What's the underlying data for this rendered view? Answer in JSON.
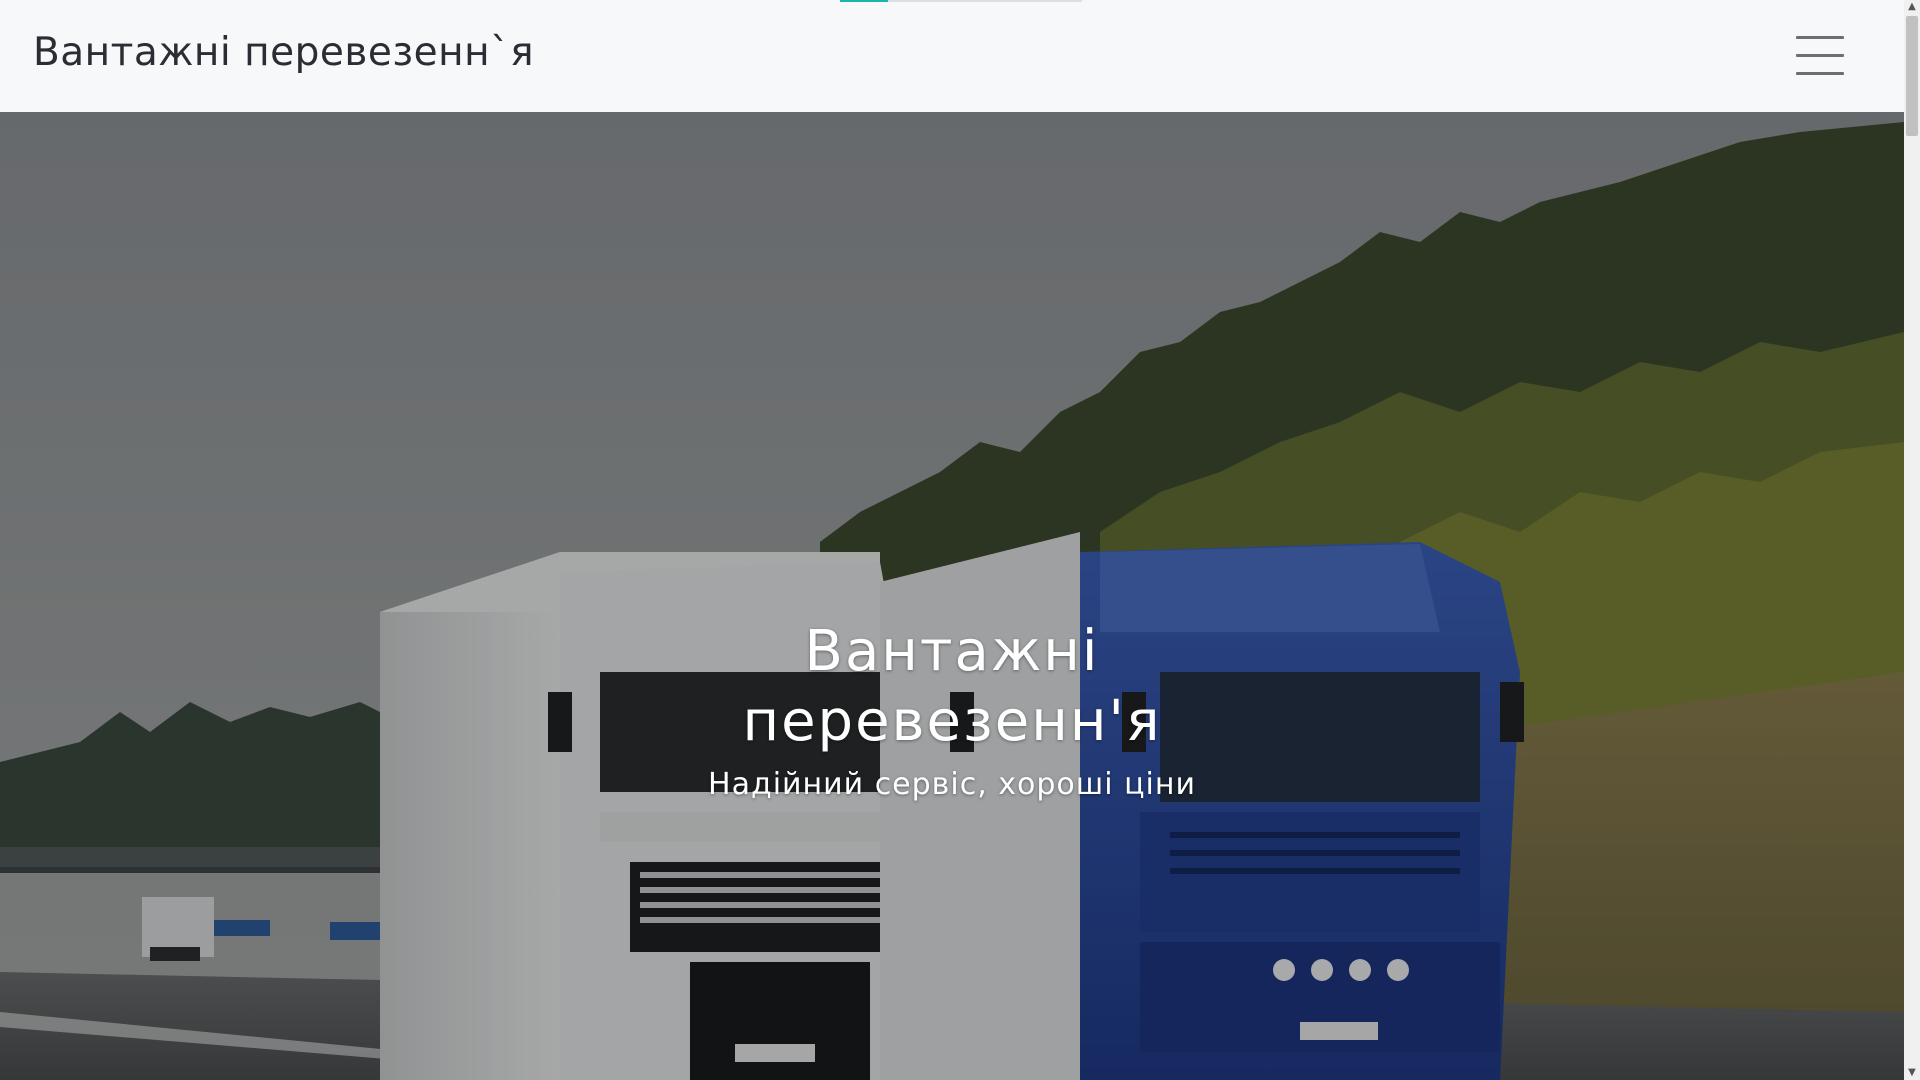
{
  "header": {
    "brand": "Вантажні перевезенн`я",
    "menu_icon": "hamburger-menu-icon",
    "progress": 0.2
  },
  "hero": {
    "title": "Вантажні перевезенн'я",
    "subtitle": "Надійний сервіс, хороші ціни"
  },
  "colors": {
    "header_bg": "#f7f8fa",
    "brand_text": "#2a2d33",
    "accent": "#1bb5b0",
    "hero_text": "#ffffff"
  }
}
